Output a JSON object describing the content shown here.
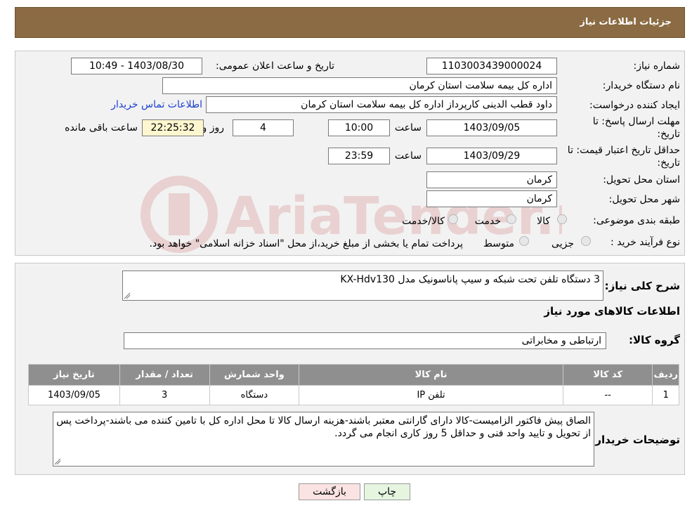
{
  "header": {
    "title": "جزئیات اطلاعات نیاز"
  },
  "watermark_text": "AriaTender.neT",
  "form": {
    "need_number_label": "شماره نیاز:",
    "need_number": "1103003439000024",
    "announce_label": "تاریخ و ساعت اعلان عمومی:",
    "announce_value": "1403/08/30 - 10:49",
    "buyer_org_label": "نام دستگاه خریدار:",
    "buyer_org": "اداره کل بیمه سلامت استان کرمان",
    "creator_label": "ایجاد کننده درخواست:",
    "creator": "داود قطب الدینی کارپرداز اداره کل بیمه سلامت استان کرمان",
    "contact_link": "اطلاعات تماس خریدار",
    "deadline_label_1": "مهلت ارسال پاسخ: تا",
    "deadline_label_2": "تاریخ:",
    "deadline_date": "1403/09/05",
    "time_label": "ساعت",
    "deadline_time": "10:00",
    "days_value": "4",
    "days_label": "روز و",
    "remaining_time": "22:25:32",
    "remaining_label": "ساعت باقی مانده",
    "validity_label_1": "حداقل تاریخ اعتبار قیمت: تا",
    "validity_label_2": "تاریخ:",
    "validity_date": "1403/09/29",
    "validity_time": "23:59",
    "province_label": "استان محل تحویل:",
    "province": "کرمان",
    "city_label": "شهر محل تحویل:",
    "city": "کرمان",
    "category_label": "طبقه بندی موضوعی:",
    "category_options": [
      "کالا",
      "خدمت",
      "کالا/خدمت"
    ],
    "process_label": "نوع فرآیند خرید :",
    "process_options": [
      "جزیی",
      "متوسط"
    ],
    "process_note": "پرداخت تمام یا بخشی از مبلغ خرید،از محل \"اسناد خزانه اسلامی\" خواهد بود."
  },
  "details": {
    "summary_label": "شرح کلی نیاز:",
    "summary": "3 دستگاه تلفن تحت شبکه و سیپ پاناسونیک مدل KX-Hdv130",
    "goods_info_title": "اطلاعات کالاهای مورد نیاز",
    "group_label": "گروه کالا:",
    "group": "ارتباطی و مخابراتی",
    "table": {
      "headers": [
        "ردیف",
        "کد کالا",
        "نام کالا",
        "واحد شمارش",
        "تعداد / مقدار",
        "تاریخ نیاز"
      ],
      "rows": [
        [
          "1",
          "--",
          "تلفن IP",
          "دستگاه",
          "3",
          "1403/09/05"
        ]
      ]
    },
    "buyer_notes_label": "توضیحات خریدار:",
    "buyer_notes": "الصاق پیش فاکتور الزامیست-کالا دارای گارانتی معتبر باشند-هزینه ارسال کالا تا محل اداره کل با تامین کننده می باشند-پرداخت پس از تحویل و تایید واحد فنی و حداقل 5 روز کاری انجام می گردد."
  },
  "buttons": {
    "print": "چاپ",
    "back": "بازگشت"
  },
  "colors": {
    "header_bg": "#8b6b43",
    "table_header_bg": "#8f8f8f",
    "back_button_bg": "#fbe3e3",
    "print_button_bg": "#e6f5e0"
  }
}
